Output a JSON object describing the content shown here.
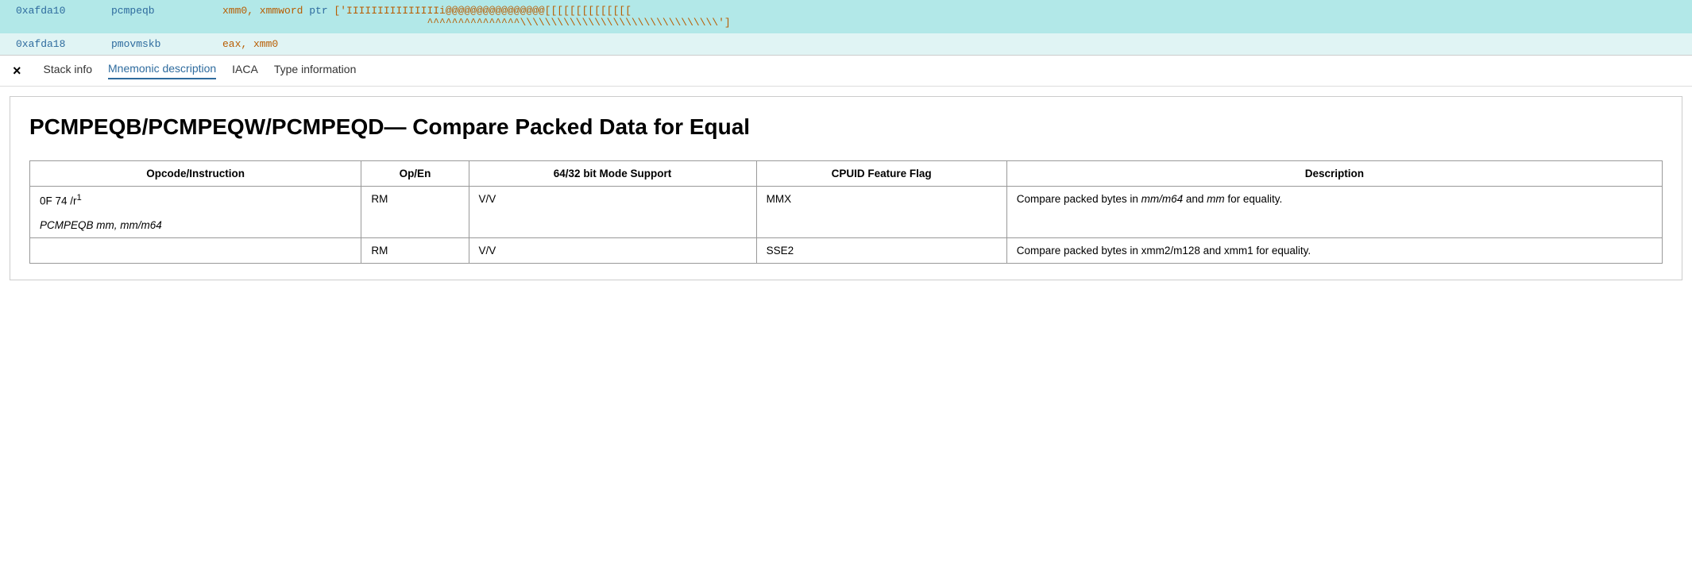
{
  "code": {
    "rows": [
      {
        "id": "row1",
        "address": "0xafda10",
        "mnemonic": "pcmpeqb",
        "operands": "xmm0, xmmword ptr ['IIIIIIIIIIIIIIIi@@@@@@@@@@@@@@@@[[[[[[[[[[[[[[",
        "operands2": "^^^^^^^^^^^^^^^\\\\\\\\\\\\\\\\\\\\\\\\\\\\\\\\']",
        "highlighted": true
      },
      {
        "id": "row2",
        "address": "0xafda18",
        "mnemonic": "pmovmskb",
        "operands": "eax, xmm0",
        "highlighted": false
      }
    ]
  },
  "tabs": {
    "close_label": "×",
    "items": [
      {
        "id": "stack-info",
        "label": "Stack info",
        "active": false
      },
      {
        "id": "mnemonic-description",
        "label": "Mnemonic description",
        "active": true
      },
      {
        "id": "iaca",
        "label": "IACA",
        "active": false
      },
      {
        "id": "type-information",
        "label": "Type information",
        "active": false
      }
    ]
  },
  "document": {
    "title": "PCMPEQB/PCMPEQW/PCMPEQD— Compare Packed Data for Equal",
    "table": {
      "headers": [
        "Opcode/Instruction",
        "Op/En",
        "64/32 bit Mode Support",
        "CPUID Feature Flag",
        "Description"
      ],
      "rows": [
        {
          "opcode": "0F 74 /r¹",
          "instruction": "PCMPEQB mm, mm/m64",
          "instruction_italic": true,
          "open_en": "RM",
          "mode_support": "V/V",
          "cpuid": "MMX",
          "description": "Compare packed bytes in mm/m64 and mm for equality."
        },
        {
          "opcode": "",
          "instruction": "",
          "open_en": "RM",
          "mode_support": "V/V",
          "cpuid": "SSE2",
          "description": "Compare packed bytes in xmm2/m128 and xmm1 for equality."
        }
      ]
    }
  }
}
